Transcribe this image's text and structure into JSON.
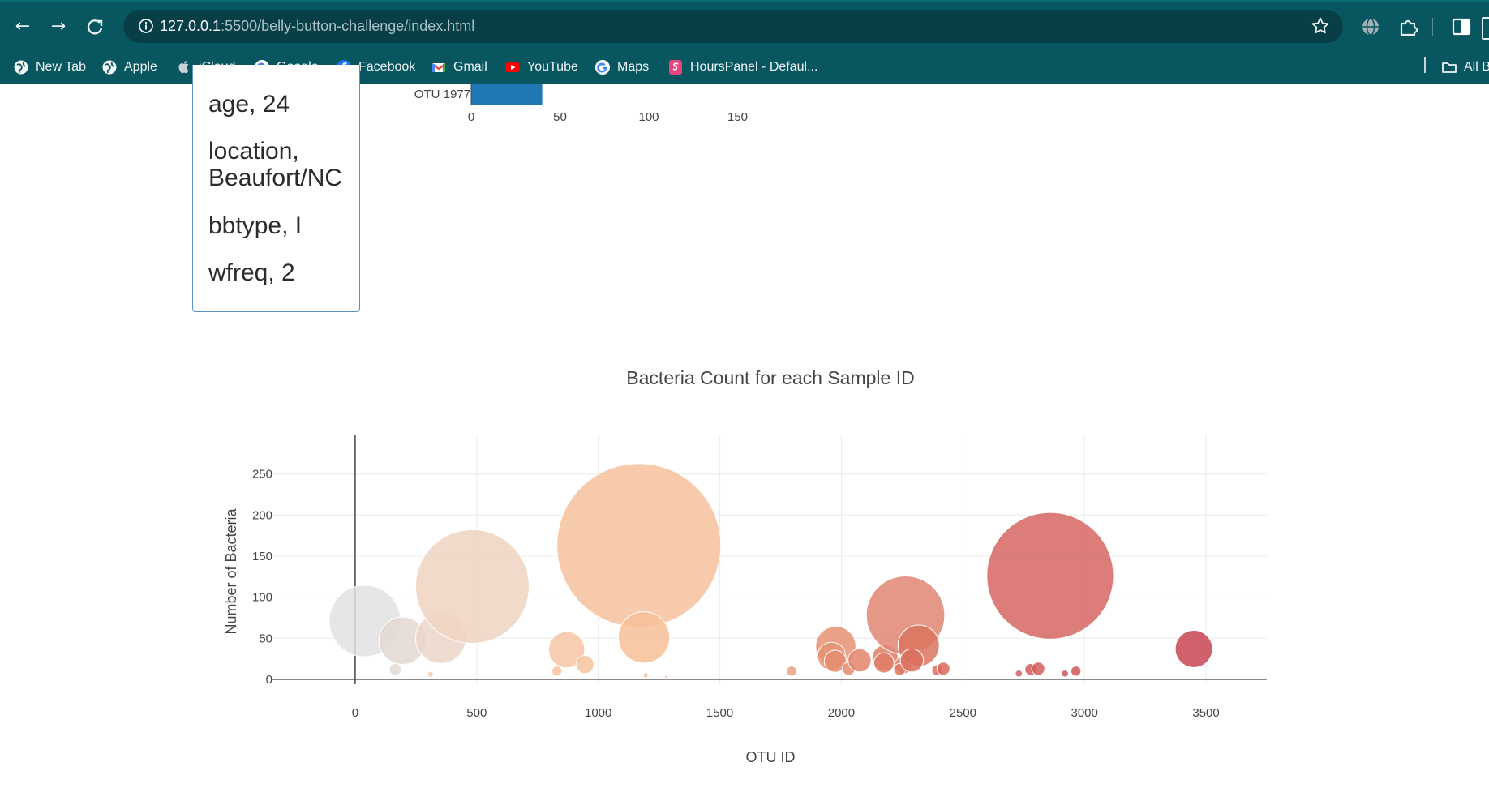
{
  "browser": {
    "url_host": "127.0.0.1",
    "url_path": ":5500/belly-button-challenge/index.html",
    "bookmarks": [
      {
        "label": "New Tab",
        "icon": "globe-icon"
      },
      {
        "label": "Apple",
        "icon": "globe-icon"
      },
      {
        "label": "iCloud",
        "icon": "apple-icon"
      },
      {
        "label": "Google",
        "icon": "google-icon"
      },
      {
        "label": "Facebook",
        "icon": "facebook-icon"
      },
      {
        "label": "Gmail",
        "icon": "gmail-icon"
      },
      {
        "label": "YouTube",
        "icon": "youtube-icon"
      },
      {
        "label": "Maps",
        "icon": "google-icon"
      },
      {
        "label": "HoursPanel - Defaul...",
        "icon": "hourspanel-icon"
      }
    ],
    "all_bookmarks_label": "All B",
    "colors": {
      "frame": "#075660",
      "omnibox": "#083f47"
    }
  },
  "metadata": {
    "lines": [
      "age, 24",
      "location,",
      "Beaufort/NC",
      "bbtype, I",
      "wfreq, 2"
    ]
  },
  "bar_chart_stub": {
    "visible_label": "OTU 1977",
    "visible_value": 40,
    "xticks": [
      0,
      50,
      100,
      150
    ],
    "bar_color": "#1f77b4"
  },
  "chart_data": {
    "type": "scatter",
    "title": "Bacteria Count for each Sample ID",
    "xlabel": "OTU ID",
    "ylabel": "Number of Bacteria",
    "xlim": [
      -340,
      3750
    ],
    "ylim": [
      -6,
      298
    ],
    "xticks": [
      0,
      500,
      1000,
      1500,
      2000,
      2500,
      3000,
      3500
    ],
    "yticks": [
      0,
      50,
      100,
      150,
      200,
      250
    ],
    "grid": true,
    "colorscale": "Earth",
    "points": [
      {
        "x": 40,
        "y": 71,
        "size": 71,
        "color": "#e2e2e2"
      },
      {
        "x": 195,
        "y": 47,
        "size": 47,
        "color": "#e3d8d2"
      },
      {
        "x": 165,
        "y": 12,
        "size": 12,
        "color": "#e4dbd7"
      },
      {
        "x": 352,
        "y": 50,
        "size": 50,
        "color": "#ecd6c8"
      },
      {
        "x": 482,
        "y": 113,
        "size": 113,
        "color": "#f0d4c2"
      },
      {
        "x": 310,
        "y": 6,
        "size": 6,
        "color": "#efcfb8"
      },
      {
        "x": 870,
        "y": 36,
        "size": 36,
        "color": "#f6c6a3"
      },
      {
        "x": 945,
        "y": 18,
        "size": 18,
        "color": "#f6c49f"
      },
      {
        "x": 830,
        "y": 10,
        "size": 10,
        "color": "#f6c49f"
      },
      {
        "x": 1167,
        "y": 163,
        "size": 163,
        "color": "#f6c19c"
      },
      {
        "x": 1188,
        "y": 51,
        "size": 51,
        "color": "#f6bf98"
      },
      {
        "x": 1195,
        "y": 5,
        "size": 5,
        "color": "#f6bf98"
      },
      {
        "x": 1280,
        "y": 3,
        "size": 3,
        "color": "#f3bb95"
      },
      {
        "x": 1795,
        "y": 10,
        "size": 10,
        "color": "#eba282"
      },
      {
        "x": 1977,
        "y": 40,
        "size": 40,
        "color": "#e79273"
      },
      {
        "x": 1960,
        "y": 28,
        "size": 28,
        "color": "#e79273"
      },
      {
        "x": 1975,
        "y": 22,
        "size": 22,
        "color": "#e58e70"
      },
      {
        "x": 2030,
        "y": 13,
        "size": 13,
        "color": "#e4896c"
      },
      {
        "x": 2075,
        "y": 23,
        "size": 23,
        "color": "#e3856a"
      },
      {
        "x": 2180,
        "y": 26,
        "size": 26,
        "color": "#e07f66"
      },
      {
        "x": 2175,
        "y": 20,
        "size": 20,
        "color": "#df7c64"
      },
      {
        "x": 2255,
        "y": 17,
        "size": 17,
        "color": "#de7861"
      },
      {
        "x": 2240,
        "y": 12,
        "size": 12,
        "color": "#de7861"
      },
      {
        "x": 2264,
        "y": 78,
        "size": 78,
        "color": "#e08672"
      },
      {
        "x": 2318,
        "y": 41,
        "size": 41,
        "color": "#dc7460"
      },
      {
        "x": 2290,
        "y": 23,
        "size": 23,
        "color": "#db705e"
      },
      {
        "x": 2395,
        "y": 11,
        "size": 11,
        "color": "#d96b5c"
      },
      {
        "x": 2420,
        "y": 13,
        "size": 13,
        "color": "#d96a5b"
      },
      {
        "x": 2730,
        "y": 7,
        "size": 7,
        "color": "#d46060"
      },
      {
        "x": 2780,
        "y": 12,
        "size": 12,
        "color": "#d25c5d"
      },
      {
        "x": 2810,
        "y": 13,
        "size": 13,
        "color": "#d25c5d"
      },
      {
        "x": 2859,
        "y": 126,
        "size": 126,
        "color": "#d66663"
      },
      {
        "x": 2920,
        "y": 7,
        "size": 7,
        "color": "#cf5758"
      },
      {
        "x": 2965,
        "y": 10,
        "size": 10,
        "color": "#cf5657"
      },
      {
        "x": 3450,
        "y": 37,
        "size": 37,
        "color": "#c94454"
      }
    ]
  }
}
